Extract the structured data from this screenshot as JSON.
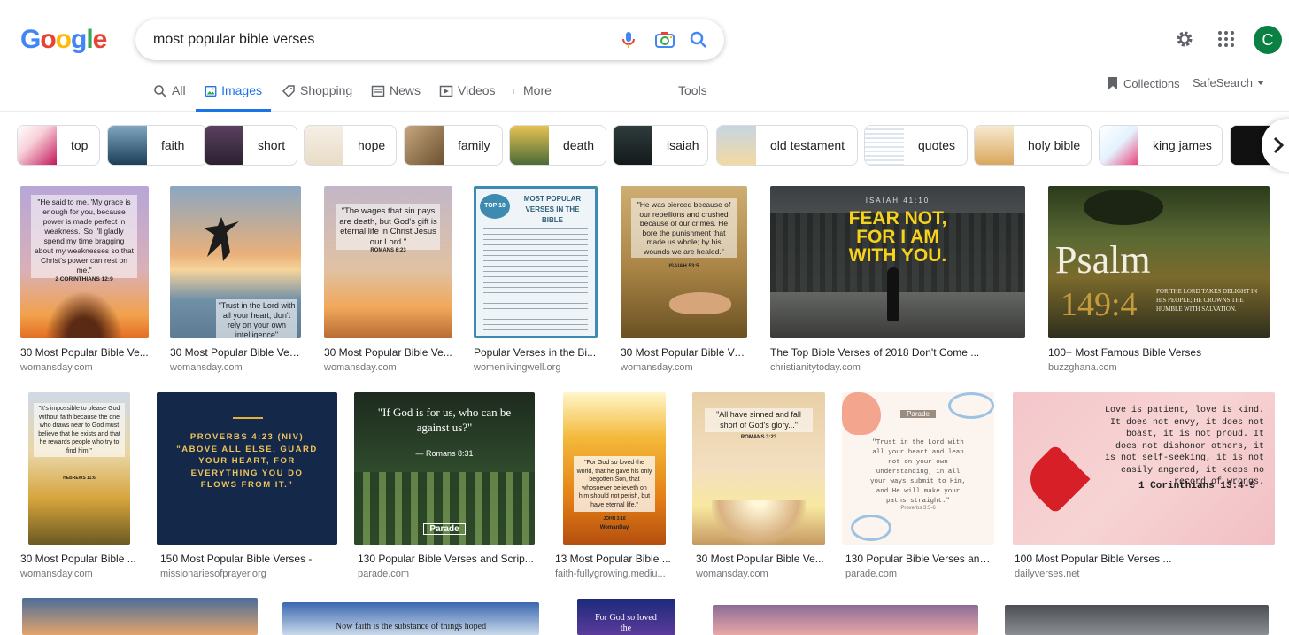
{
  "search": {
    "query": "most popular bible verses"
  },
  "logo": {
    "letters": [
      "G",
      "o",
      "o",
      "g",
      "l",
      "e"
    ]
  },
  "colors": {
    "blue": "#4285f4",
    "red": "#ea4335",
    "yellow": "#fbbc05",
    "green": "#34a853",
    "accent": "#1a73e8",
    "avatar": "#0b8043"
  },
  "header": {
    "avatar_letter": "C"
  },
  "tabs": [
    {
      "label": "All",
      "icon": "search-icon"
    },
    {
      "label": "Images",
      "icon": "image-icon"
    },
    {
      "label": "Shopping",
      "icon": "tag-icon"
    },
    {
      "label": "News",
      "icon": "news-icon"
    },
    {
      "label": "Videos",
      "icon": "video-icon"
    },
    {
      "label": "More",
      "icon": "more-vert-icon"
    }
  ],
  "tools_label": "Tools",
  "collections_label": "Collections",
  "safesearch_label": "SafeSearch",
  "chips": [
    "top",
    "faith",
    "short",
    "hope",
    "family",
    "death",
    "isaiah",
    "old testament",
    "quotes",
    "holy bible",
    "king james"
  ],
  "results_row1": [
    {
      "title": "30 Most Popular Bible Ve...",
      "source": "womansday.com",
      "text": "\"He said to me, 'My grace is enough for you, because power is made perfect in weakness.' So I'll gladly spend my time bragging about my weaknesses so that Christ's power can rest on me.\"",
      "ref": "2 CORINTHIANS 12:9"
    },
    {
      "title": "30 Most Popular Bible Ver...",
      "source": "womansday.com",
      "text": "\"Trust in the Lord with all your heart; don't rely on your own intelligence\""
    },
    {
      "title": "30 Most Popular Bible Ve...",
      "source": "womansday.com",
      "text": "\"The wages that sin pays are death, but God's gift is eternal life in Christ Jesus our Lord.\"",
      "ref": "ROMANS 6:23"
    },
    {
      "title": "Popular Verses in the Bi...",
      "source": "womenlivingwell.org",
      "text": "MOST POPULAR VERSES IN THE BIBLE",
      "badge": "TOP 10"
    },
    {
      "title": "30 Most Popular Bible Ve...",
      "source": "womansday.com",
      "text": "\"He was pierced because of our rebellions and crushed because of our crimes. He bore the punishment that made us whole; by his wounds we are healed.\"",
      "ref": "ISAIAH 53:5"
    },
    {
      "title": "The Top Bible Verses of 2018 Don't Come ...",
      "source": "christianitytoday.com",
      "text": "FEAR NOT, FOR I AM WITH YOU.",
      "ref": "ISAIAH 41:10"
    },
    {
      "title": "100+ Most Famous Bible Verses",
      "source": "buzzghana.com",
      "text": "Psalm",
      "num": "149:4",
      "sub": "FOR THE LORD TAKES DELIGHT IN HIS PEOPLE; HE CROWNS THE HUMBLE WITH SALVATION."
    }
  ],
  "results_row2": [
    {
      "title": "30 Most Popular Bible ...",
      "source": "womansday.com",
      "text": "\"It's impossible to please God without faith because the one who draws near to God must believe that he exists and that he rewards people who try to find him.\"",
      "ref": "HEBREWS 11:6"
    },
    {
      "title": "150 Most Popular Bible Verses -",
      "source": "missionariesofprayer.org",
      "text": "PROVERBS 4:23 (NIV) \"ABOVE ALL ELSE, GUARD YOUR HEART, FOR EVERYTHING YOU DO FLOWS FROM IT.\""
    },
    {
      "title": "130 Popular Bible Verses and Scrip...",
      "source": "parade.com",
      "text": "\"If God is for us, who can be against us?\"",
      "ref": "— Romans 8:31",
      "brand": "Parade"
    },
    {
      "title": "13 Most Popular Bible ...",
      "source": "faith-fullygrowing.mediu...",
      "text": "\"For God so loved the world, that he gave his only begotten Son, that whosoever believeth on him should not perish, but have eternal life.\"",
      "ref": "JOHN 3:16",
      "brand": "WomanDay"
    },
    {
      "title": "30 Most Popular Bible Ve...",
      "source": "womansday.com",
      "text": "\"All have sinned and fall short of God's glory...\"",
      "ref": "ROMANS 3:23"
    },
    {
      "title": "130 Popular Bible Verses and...",
      "source": "parade.com",
      "text": "\"Trust in the Lord with all your heart and lean not on your own understanding; in all your ways submit to Him, and He will make your paths straight.\"",
      "ref": "Proverbs 3:5-6",
      "brand": "Parade"
    },
    {
      "title": "100 Most Popular Bible Verses ...",
      "source": "dailyverses.net",
      "text": "Love is patient, love is kind. It does not envy, it does not boast, it is not proud. It does not dishonor others, it is not self-seeking, it is not easily angered, it keeps no record of wrongs.",
      "ref": "1 Corinthians 13:4-5"
    }
  ],
  "results_row3": [
    {
      "text": ""
    },
    {
      "text": "Now faith is the substance of things hoped"
    },
    {
      "text": "For God so loved the"
    },
    {
      "text": ""
    },
    {
      "text": ""
    }
  ]
}
